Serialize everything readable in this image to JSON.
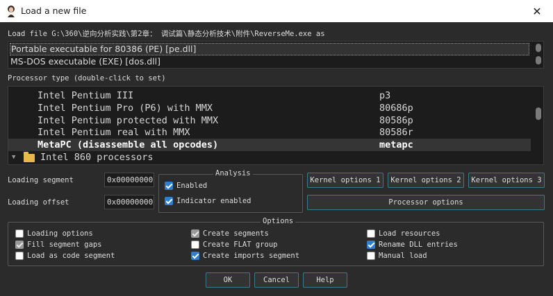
{
  "window": {
    "title": "Load a new file",
    "close_glyph": "✕",
    "app_icon": "app-icon"
  },
  "load_file_label": "Load file G:\\360\\逆向分析实践\\第2章： 调试篇\\静态分析技术\\附件\\ReverseMe.exe as",
  "file_formats": [
    {
      "label": "Portable executable for 80386 (PE) [pe.dll]",
      "selected": true
    },
    {
      "label": "MS-DOS executable (EXE) [dos.dll]",
      "selected": false
    }
  ],
  "processor_type_label": "Processor type (double-click to set)",
  "processors": [
    {
      "name": "Intel Pentium III",
      "code": "p3",
      "selected": false,
      "group": false
    },
    {
      "name": "Intel Pentium Pro (P6) with MMX",
      "code": "80686p",
      "selected": false,
      "group": false
    },
    {
      "name": "Intel Pentium protected with MMX",
      "code": "80586p",
      "selected": false,
      "group": false
    },
    {
      "name": "Intel Pentium real with MMX",
      "code": "80586r",
      "selected": false,
      "group": false
    },
    {
      "name": "MetaPC (disassemble all opcodes)",
      "code": "metapc",
      "selected": true,
      "group": false
    },
    {
      "name": "Intel 860 processors",
      "code": "",
      "selected": false,
      "group": true
    }
  ],
  "loading_segment": {
    "label": "Loading segment",
    "value": "0x00000000"
  },
  "loading_offset": {
    "label": "Loading offset",
    "value": "0x00000000"
  },
  "analysis": {
    "title": "Analysis",
    "enabled": {
      "label": "Enabled",
      "checked": true
    },
    "indicator": {
      "label": "Indicator enabled",
      "checked": true
    }
  },
  "kernel_buttons": [
    "Kernel options 1",
    "Kernel options 2",
    "Kernel options 3"
  ],
  "processor_options_button": "Processor options",
  "options": {
    "title": "Options",
    "col1": [
      {
        "label": "Loading options",
        "checked": false,
        "disabled": false
      },
      {
        "label": "Fill segment gaps",
        "checked": true,
        "disabled": true
      },
      {
        "label": "Load as code segment",
        "checked": false,
        "disabled": false
      }
    ],
    "col2": [
      {
        "label": "Create segments",
        "checked": true,
        "disabled": true
      },
      {
        "label": "Create FLAT group",
        "checked": false,
        "disabled": false
      },
      {
        "label": "Create imports segment",
        "checked": true,
        "disabled": false
      }
    ],
    "col3": [
      {
        "label": "Load resources",
        "checked": false,
        "disabled": false
      },
      {
        "label": "Rename DLL entries",
        "checked": true,
        "disabled": false
      },
      {
        "label": "Manual load",
        "checked": false,
        "disabled": false
      }
    ]
  },
  "buttons": {
    "ok": "OK",
    "cancel": "Cancel",
    "help": "Help"
  },
  "colors": {
    "accent": "#2f7fd0",
    "button_border": "#3a7a8a",
    "background": "#2b2b2b"
  }
}
